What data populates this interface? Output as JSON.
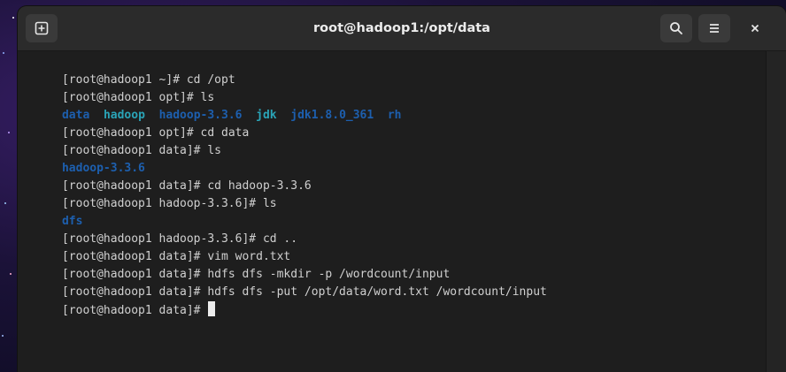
{
  "window": {
    "title": "root@hadoop1:/opt/data",
    "icons": {
      "new_tab": "new-tab-icon",
      "search": "search-icon",
      "menu": "hamburger-menu-icon",
      "close": "close-icon"
    }
  },
  "colors": {
    "dir_blue": "#1d5fae",
    "dir_cyan": "#2aa4b7",
    "text": "#d0d0d0",
    "background": "#1e1e1e"
  },
  "terminal": {
    "lines": [
      {
        "prompt": "[root@hadoop1 ~]# ",
        "command": "cd /opt"
      },
      {
        "prompt": "[root@hadoop1 opt]# ",
        "command": "ls"
      },
      {
        "entries": [
          "data",
          "hadoop",
          "hadoop-3.3.6",
          "jdk",
          "jdk1.8.0_361",
          "rh"
        ]
      },
      {
        "prompt": "[root@hadoop1 opt]# ",
        "command": "cd data"
      },
      {
        "prompt": "[root@hadoop1 data]# ",
        "command": "ls"
      },
      {
        "output": "hadoop-3.3.6"
      },
      {
        "prompt": "[root@hadoop1 data]# ",
        "command": "cd hadoop-3.3.6"
      },
      {
        "prompt": "[root@hadoop1 hadoop-3.3.6]# ",
        "command": "ls"
      },
      {
        "output": "dfs"
      },
      {
        "prompt": "[root@hadoop1 hadoop-3.3.6]# ",
        "command": "cd .."
      },
      {
        "prompt": "[root@hadoop1 data]# ",
        "command": "vim word.txt"
      },
      {
        "prompt": "[root@hadoop1 data]# ",
        "command": "hdfs dfs -mkdir -p /wordcount/input"
      },
      {
        "prompt": "[root@hadoop1 data]# ",
        "command": "hdfs dfs -put /opt/data/word.txt /wordcount/input"
      },
      {
        "prompt": "[root@hadoop1 data]# ",
        "command": ""
      }
    ]
  }
}
